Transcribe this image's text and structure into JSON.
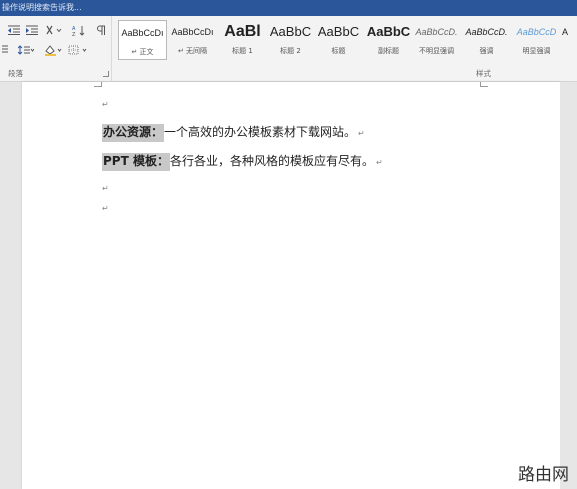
{
  "titlebar": {
    "tell_me": "操作说明搜索告诉我..."
  },
  "ribbon": {
    "paragraph_group_label": "段落",
    "styles_group_label": "样式",
    "styles": [
      {
        "preview": "AaBbCcDı",
        "name": "↵ 正文",
        "selected": true
      },
      {
        "preview": "AaBbCcDı",
        "name": "↵ 无间隔",
        "selected": false
      },
      {
        "preview": "AaBl",
        "name": "标题 1",
        "selected": false
      },
      {
        "preview": "AaBbC",
        "name": "标题 2",
        "selected": false
      },
      {
        "preview": "AaBbC",
        "name": "标题",
        "selected": false
      },
      {
        "preview": "AaBbC",
        "name": "副标题",
        "selected": false
      },
      {
        "preview": "AaBbCcD.",
        "name": "不明显强调",
        "selected": false
      },
      {
        "preview": "AaBbCcD.",
        "name": "强调",
        "selected": false
      },
      {
        "preview": "AaBbCcD",
        "name": "明显强调",
        "selected": false
      }
    ]
  },
  "document": {
    "paragraph_mark": "↵",
    "lines": [
      {
        "label": "办公资源：",
        "text": "一个高效的办公模板素材下载网站。"
      },
      {
        "label": "PPT 模板：",
        "text": "各行各业，各种风格的模板应有尽有。"
      }
    ]
  },
  "watermark": "路由网"
}
